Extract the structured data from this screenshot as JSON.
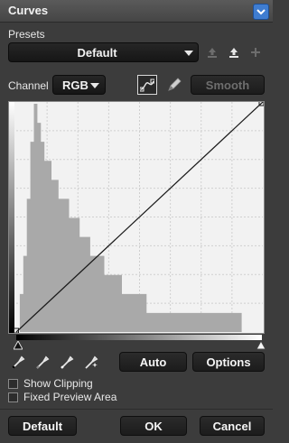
{
  "panel": {
    "title": "Curves"
  },
  "presets": {
    "label": "Presets",
    "selected": "Default"
  },
  "channel": {
    "label": "Channel",
    "selected": "RGB"
  },
  "smooth_label": "Smooth",
  "buttons": {
    "auto": "Auto",
    "options": "Options",
    "default": "Default",
    "ok": "OK",
    "cancel": "Cancel"
  },
  "checkboxes": [
    {
      "label": "Show Clipping",
      "checked": false
    },
    {
      "label": "Fixed Preview Area",
      "checked": false
    }
  ],
  "icons": {
    "panel_menu": "chevron-down-icon",
    "load_preset": "upload-icon",
    "save_preset": "save-icon",
    "add_preset": "plus-icon",
    "curve_tool": "curve-point-icon",
    "pencil_tool": "pencil-icon",
    "eyedroppers": [
      "black-eyedropper-icon",
      "gray-eyedropper-icon",
      "white-eyedropper-icon",
      "auto-eyedropper-icon"
    ]
  },
  "colors": {
    "panel_bg": "#3c3c3c",
    "accent": "#3f7dd1",
    "histogram": "#a9a9a9",
    "graph_bg": "#f2f2f2",
    "grid": "#cfcfcf"
  },
  "curve": {
    "points": [
      [
        0,
        0
      ],
      [
        255,
        255
      ]
    ]
  },
  "histogram": {
    "bins": [
      0,
      2,
      4,
      7,
      10,
      12,
      11,
      10,
      9,
      9,
      8,
      8,
      7,
      7,
      7,
      6,
      6,
      6,
      5,
      5,
      5,
      4,
      4,
      4,
      4,
      3,
      3,
      3,
      3,
      3,
      2,
      2,
      2,
      2,
      2,
      2,
      2,
      1,
      1,
      1,
      1,
      1,
      1,
      1,
      1,
      1,
      1,
      1,
      1,
      1,
      1,
      1,
      1,
      1,
      1,
      1,
      1,
      1,
      1,
      1,
      1,
      1,
      1,
      1,
      0,
      0,
      0,
      0,
      0,
      0
    ]
  }
}
